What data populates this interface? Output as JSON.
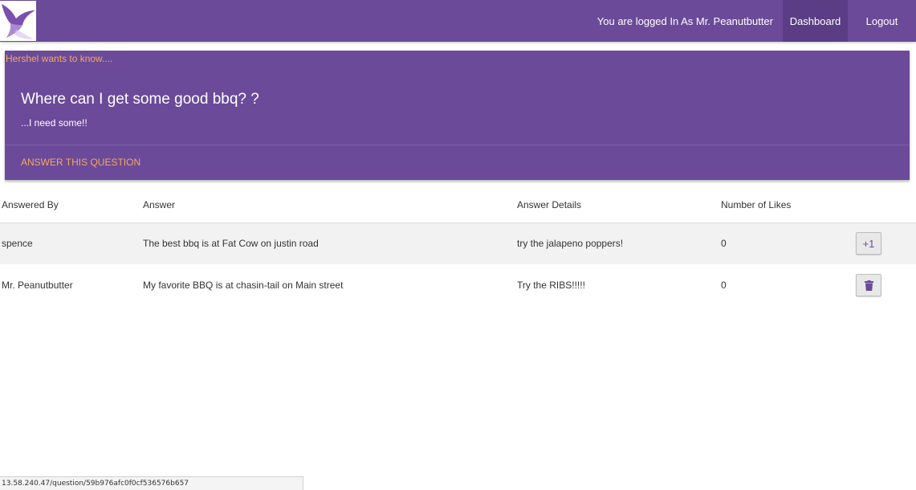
{
  "nav": {
    "logo_icon": "bird-logo-icon",
    "status_text": "You are logged In As Mr. Peanutbutter",
    "links": [
      {
        "label": "Dashboard"
      },
      {
        "label": "Logout"
      }
    ]
  },
  "question": {
    "asker_text": "Hershel wants to know....",
    "title": "Where can I get some good bbq? ?",
    "body": "...I need some!!",
    "answer_label": "ANSWER THIS QUESTION"
  },
  "table": {
    "headers": [
      "Answered By",
      "Answer",
      "Answer Details",
      "Number of Likes"
    ],
    "rows": [
      {
        "answered_by": "spence",
        "answer": "The best bbq is at Fat Cow on justin road",
        "details": "try the jalapeno poppers!",
        "likes": "0",
        "action_label": "+1",
        "action_icon": "plus-one"
      },
      {
        "answered_by": "Mr. Peanutbutter",
        "answer": "My favorite BBQ is at chasin-tail on Main street",
        "details": "Try the RIBS!!!!!",
        "likes": "0",
        "action_label": "",
        "action_icon": "trash-icon"
      }
    ]
  },
  "status_bar": {
    "url": "13.58.240.47/question/59b976afc0f0cf536576b657"
  },
  "colors": {
    "brand_purple": "#6b4a99",
    "active_nav": "#5a3d85",
    "accent_orange": "#f4a860"
  }
}
